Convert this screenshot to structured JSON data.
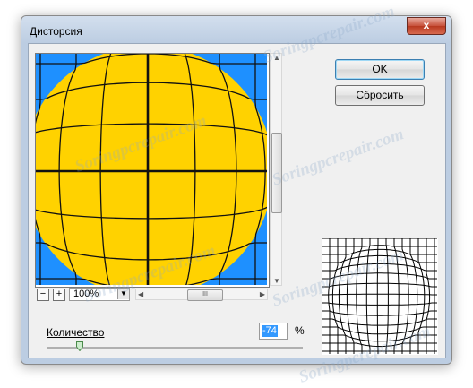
{
  "window": {
    "title": "Дисторсия",
    "close_label": "x"
  },
  "buttons": {
    "ok": "OK",
    "reset": "Сбросить"
  },
  "zoom": {
    "minus": "−",
    "plus": "+",
    "value": "100%"
  },
  "amount": {
    "label": "Количество",
    "value": "-74",
    "unit": "%",
    "slider_fraction": 0.13
  },
  "watermark": "Soringpcrepair.com",
  "colors": {
    "yellow": "#ffd200",
    "blue": "#1e90ff",
    "grid": "#111111"
  },
  "icons": {
    "dropdown": "chevron-down-icon",
    "scroll_grip": "grip-icon"
  }
}
